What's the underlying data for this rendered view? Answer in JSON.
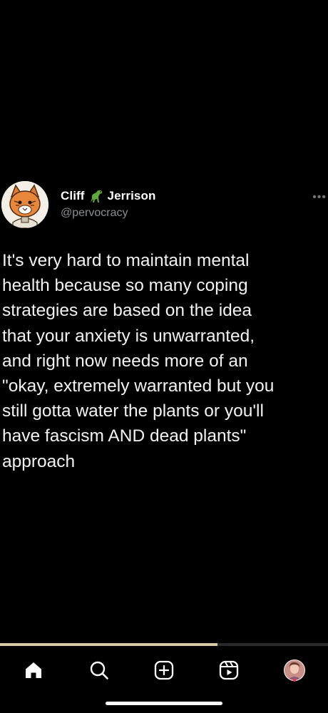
{
  "tweet": {
    "display_name_first": "Cliff",
    "display_name_last": "Jerrison",
    "name_emoji": "dinosaur-emoji",
    "handle": "@pervocracy",
    "more_label": "•••",
    "text": "It's very hard to maintain mental\nhealth because so many coping\nstrategies are based on the idea\nthat your anxiety is unwarranted,\nand right now needs more of an\n\"okay, extremely warranted but you\nstill gotta water the plants or you'll\nhave fascism AND dead plants\"\napproach"
  },
  "nav": {
    "items": [
      {
        "icon": "home-icon",
        "active": true
      },
      {
        "icon": "search-icon",
        "active": false
      },
      {
        "icon": "create-plus-icon",
        "active": false
      },
      {
        "icon": "reels-icon",
        "active": false
      },
      {
        "icon": "profile-avatar",
        "active": false,
        "has_notification": true
      }
    ]
  },
  "colors": {
    "background": "#000000",
    "text": "#f2f2f2",
    "handle": "#8a8d91",
    "notification_dot": "#ff3040"
  }
}
